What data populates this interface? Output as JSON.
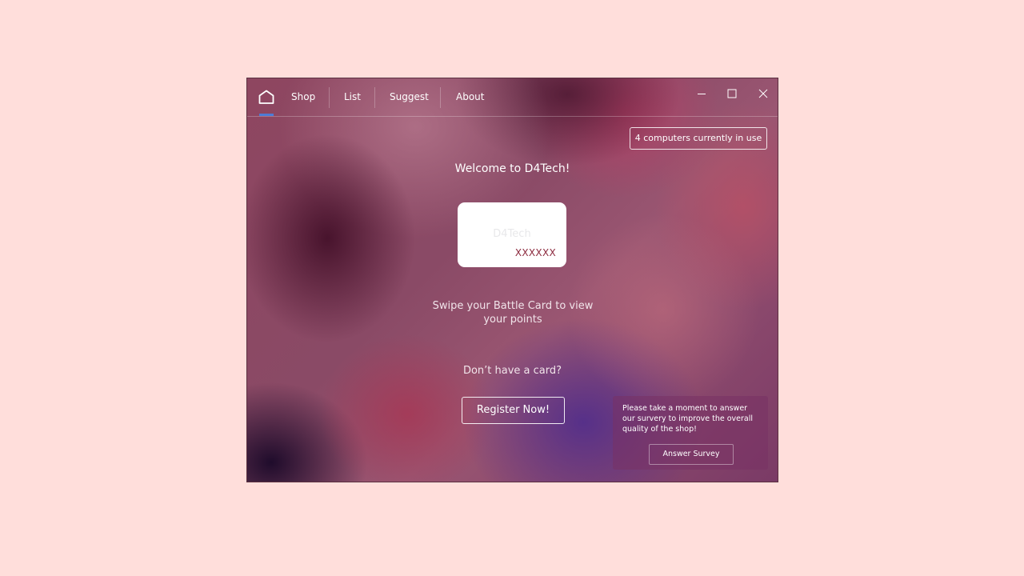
{
  "nav": {
    "tabs": [
      {
        "label": "Shop"
      },
      {
        "label": "List"
      },
      {
        "label": "Suggest"
      },
      {
        "label": "About"
      }
    ],
    "home_icon": "home-icon",
    "accent_color": "#4d7bd6"
  },
  "window_controls": {
    "minimize_icon": "minimize-icon",
    "maximize_icon": "maximize-icon",
    "close_icon": "close-icon"
  },
  "status": {
    "computers_in_use": "4 computers currently in use"
  },
  "main": {
    "welcome": "Welcome to D4Tech!",
    "card": {
      "brand": "D4Tech",
      "number": "XXXXXX"
    },
    "swipe_prompt": "Swipe your Battle Card to view your points",
    "no_card_prompt": "Don’t have a card?",
    "register_label": "Register Now!"
  },
  "survey": {
    "message": "Please take a moment to answer our survery to improve the overall quality of the shop!",
    "button_label": "Answer Survey"
  }
}
